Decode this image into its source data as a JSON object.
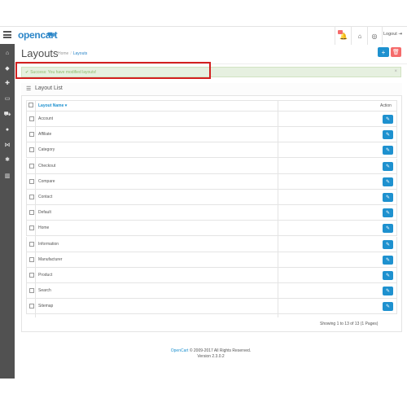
{
  "header": {
    "logo_text": "opencart",
    "logout_label": "Logout",
    "notification_count": "1",
    "icons": [
      "menu-icon",
      "bell-icon",
      "home-icon",
      "lifebuoy-icon",
      "sign-out-icon"
    ]
  },
  "sidebar": {
    "items": [
      {
        "icon": "dashboard-icon",
        "glyph": "⌂"
      },
      {
        "icon": "tags-icon",
        "glyph": "◆"
      },
      {
        "icon": "extension-icon",
        "glyph": "✚"
      },
      {
        "icon": "design-icon",
        "glyph": "▭"
      },
      {
        "icon": "sales-icon",
        "glyph": "⛟"
      },
      {
        "icon": "customers-icon",
        "glyph": "●"
      },
      {
        "icon": "marketing-icon",
        "glyph": "⋈"
      },
      {
        "icon": "system-icon",
        "glyph": "✱"
      },
      {
        "icon": "reports-icon",
        "glyph": "▥"
      }
    ]
  },
  "page": {
    "title": "Layouts",
    "breadcrumb": [
      "Home",
      "Layouts"
    ],
    "add_icon": "plus-icon",
    "delete_icon": "trash-icon"
  },
  "alert": {
    "text": "Success: You have modified layouts!",
    "close": "×"
  },
  "panel": {
    "title": "Layout List"
  },
  "table": {
    "column_name": "Layout Name ▾",
    "column_action": "Action",
    "rows": [
      "Account",
      "Affiliate",
      "Category",
      "Checkout",
      "Compare",
      "Contact",
      "Default",
      "Home",
      "Information",
      "Manufacturer",
      "Product",
      "Search",
      "Sitemap"
    ]
  },
  "pagination": {
    "info": "Showing 1 to 13 of 13 (1 Pages)"
  },
  "footer": {
    "link": "OpenCart",
    "copyright": " © 2009-2017 All Rights Reserved.",
    "version": "Version 2.3.0.2"
  },
  "colors": {
    "accent": "#1e91cf",
    "danger": "#f56b6b",
    "success_bg": "#e6f0e0",
    "sidebar": "#515151"
  }
}
